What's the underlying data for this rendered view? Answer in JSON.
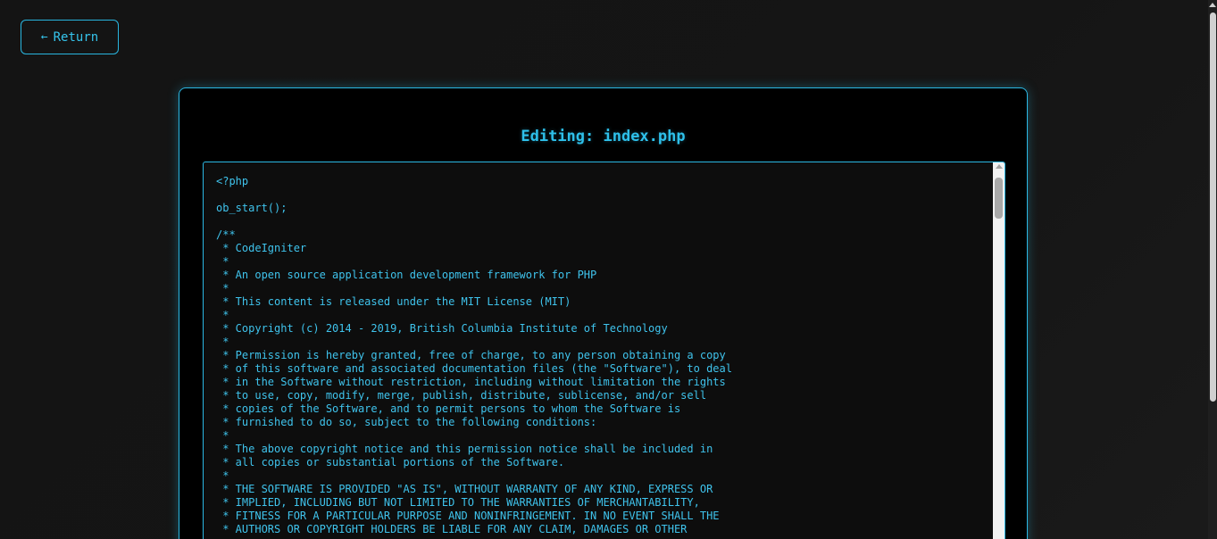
{
  "return_button": {
    "label": "Return",
    "arrow": "←"
  },
  "editor": {
    "title": "Editing: index.php",
    "content": "<?php\n\nob_start();\n\n/**\n * CodeIgniter\n *\n * An open source application development framework for PHP\n *\n * This content is released under the MIT License (MIT)\n *\n * Copyright (c) 2014 - 2019, British Columbia Institute of Technology\n *\n * Permission is hereby granted, free of charge, to any person obtaining a copy\n * of this software and associated documentation files (the \"Software\"), to deal\n * in the Software without restriction, including without limitation the rights\n * to use, copy, modify, merge, publish, distribute, sublicense, and/or sell\n * copies of the Software, and to permit persons to whom the Software is\n * furnished to do so, subject to the following conditions:\n *\n * The above copyright notice and this permission notice shall be included in\n * all copies or substantial portions of the Software.\n *\n * THE SOFTWARE IS PROVIDED \"AS IS\", WITHOUT WARRANTY OF ANY KIND, EXPRESS OR\n * IMPLIED, INCLUDING BUT NOT LIMITED TO THE WARRANTIES OF MERCHANTABILITY,\n * FITNESS FOR A PARTICULAR PURPOSE AND NONINFRINGEMENT. IN NO EVENT SHALL THE\n * AUTHORS OR COPYRIGHT HOLDERS BE LIABLE FOR ANY CLAIM, DAMAGES OR OTHER"
  },
  "colors": {
    "accent": "#29b6e0",
    "text": "#3fc3ec",
    "background": "#121212",
    "panel": "#000000"
  }
}
